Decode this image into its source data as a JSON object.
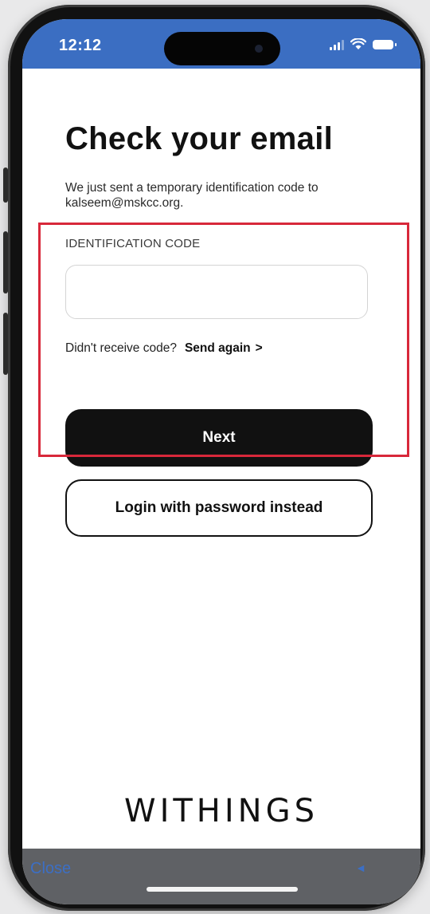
{
  "status_bar": {
    "time": "12:12",
    "background_color": "#3b6ec2"
  },
  "page": {
    "title": "Check your email",
    "subtitle": "We just sent a temporary identification code to kalseem@mskcc.org."
  },
  "form": {
    "code_label": "IDENTIFICATION CODE",
    "code_value": "",
    "code_placeholder": "",
    "resend_prompt": "Didn't receive code?",
    "resend_link": "Send again",
    "resend_chevron": ">",
    "next_button": "Next",
    "password_button": "Login with password instead"
  },
  "annotation": {
    "highlight_color": "#d8283a"
  },
  "brand": {
    "logo_text": "WITHINGS"
  },
  "bottom_bar": {
    "close_label": "Close",
    "back_icon": "back-arrow-icon"
  },
  "colors": {
    "primary_button": "#111111",
    "link_blue": "#3c6fc5"
  }
}
